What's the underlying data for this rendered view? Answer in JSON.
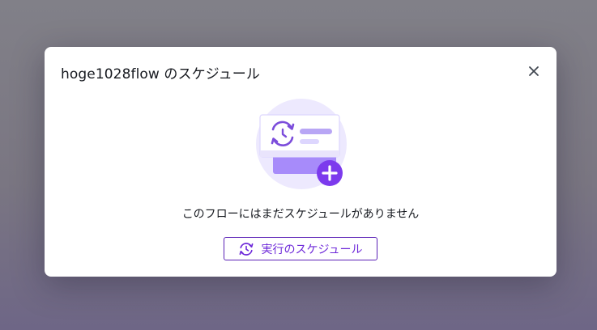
{
  "dialog": {
    "title": "hoge1028flow のスケジュール",
    "close_icon": "close-icon",
    "empty_state": {
      "illustration": "schedule-empty-illustration",
      "message": "このフローにはまだスケジュールがありません"
    },
    "primary_action": {
      "label": "実行のスケジュール",
      "icon": "refresh-clock-icon"
    }
  },
  "colors": {
    "accent": "#6d28d9",
    "accent_light": "#ede9fe",
    "accent_mid": "#a78bfa",
    "text": "#16191f",
    "backdrop": "#7d7a85"
  }
}
